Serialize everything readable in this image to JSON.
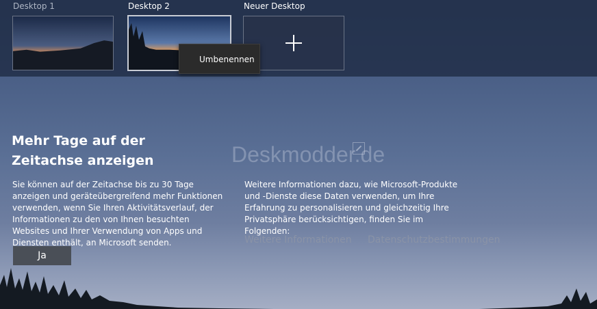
{
  "desktops": [
    {
      "label": "Desktop 1",
      "active": false
    },
    {
      "label": "Desktop 2",
      "active": true
    }
  ],
  "new_desktop": {
    "label": "Neuer Desktop",
    "icon": "plus-icon"
  },
  "context_menu": {
    "items": [
      "Umbenennen"
    ]
  },
  "watermark": "Deskmodder.de",
  "dialog": {
    "title": "Mehr Tage auf der Zeitachse anzeigen",
    "left_text": "Sie können auf der Zeitachse bis zu 30 Tage anzeigen und geräteübergreifend mehr Funktionen verwenden, wenn Sie Ihren Aktivitätsverlauf, der Informationen zu den von Ihnen besuchten Websites und Ihrer Verwendung von Apps und Diensten enthält, an Microsoft senden.",
    "right_text": "Weitere Informationen dazu, wie Microsoft-Produkte und -Dienste diese Daten verwenden, um Ihre Erfahrung zu personalisieren und gleichzeitig Ihre Privatsphäre berücksichtigen, finden Sie im Folgenden:",
    "link_more_info": "Weitere Informationen",
    "link_privacy": "Datenschutzbestimmungen",
    "yes_button": "Ja"
  }
}
